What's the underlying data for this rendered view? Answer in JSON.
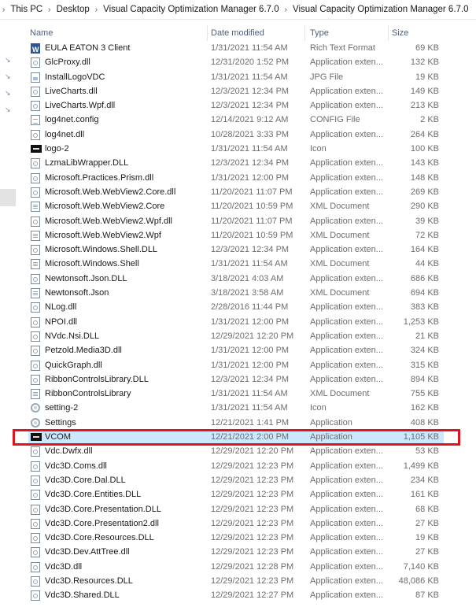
{
  "breadcrumb": [
    "This PC",
    "Desktop",
    "Visual Capacity Optimization Manager 6.7.0",
    "Visual Capacity Optimization Manager 6.7.0"
  ],
  "columns": {
    "name": "Name",
    "date": "Date modified",
    "type": "Type",
    "size": "Size"
  },
  "highlight_color": "#e0141e",
  "selection_color": "#cce8ff",
  "files": [
    {
      "name": "EULA EATON 3 Client",
      "date": "1/31/2021 11:54 AM",
      "type": "Rich Text Format",
      "size": "69 KB",
      "icon": "word-document-icon"
    },
    {
      "name": "GlcProxy.dll",
      "date": "12/31/2020 1:52 PM",
      "type": "Application exten...",
      "size": "132 KB",
      "icon": "dll-file-icon"
    },
    {
      "name": "InstallLogoVDC",
      "date": "1/31/2021 11:54 AM",
      "type": "JPG File",
      "size": "19 KB",
      "icon": "image-file-icon"
    },
    {
      "name": "LiveCharts.dll",
      "date": "12/3/2021 12:34 PM",
      "type": "Application exten...",
      "size": "149 KB",
      "icon": "dll-file-icon"
    },
    {
      "name": "LiveCharts.Wpf.dll",
      "date": "12/3/2021 12:34 PM",
      "type": "Application exten...",
      "size": "213 KB",
      "icon": "dll-file-icon"
    },
    {
      "name": "log4net.config",
      "date": "12/14/2021 9:12 AM",
      "type": "CONFIG File",
      "size": "2 KB",
      "icon": "config-file-icon"
    },
    {
      "name": "log4net.dll",
      "date": "10/28/2021 3:33 PM",
      "type": "Application exten...",
      "size": "264 KB",
      "icon": "dll-file-icon"
    },
    {
      "name": "logo-2",
      "date": "1/31/2021 11:54 AM",
      "type": "Icon",
      "size": "100 KB",
      "icon": "eaton-logo-icon"
    },
    {
      "name": "LzmaLibWrapper.DLL",
      "date": "12/3/2021 12:34 PM",
      "type": "Application exten...",
      "size": "143 KB",
      "icon": "dll-file-icon"
    },
    {
      "name": "Microsoft.Practices.Prism.dll",
      "date": "1/31/2021 12:00 PM",
      "type": "Application exten...",
      "size": "148 KB",
      "icon": "dll-file-icon"
    },
    {
      "name": "Microsoft.Web.WebView2.Core.dll",
      "date": "11/20/2021 11:07 PM",
      "type": "Application exten...",
      "size": "269 KB",
      "icon": "dll-file-icon"
    },
    {
      "name": "Microsoft.Web.WebView2.Core",
      "date": "11/20/2021 10:59 PM",
      "type": "XML Document",
      "size": "290 KB",
      "icon": "xml-file-icon"
    },
    {
      "name": "Microsoft.Web.WebView2.Wpf.dll",
      "date": "11/20/2021 11:07 PM",
      "type": "Application exten...",
      "size": "39 KB",
      "icon": "dll-file-icon"
    },
    {
      "name": "Microsoft.Web.WebView2.Wpf",
      "date": "11/20/2021 10:59 PM",
      "type": "XML Document",
      "size": "72 KB",
      "icon": "xml-file-icon"
    },
    {
      "name": "Microsoft.Windows.Shell.DLL",
      "date": "12/3/2021 12:34 PM",
      "type": "Application exten...",
      "size": "164 KB",
      "icon": "dll-file-icon"
    },
    {
      "name": "Microsoft.Windows.Shell",
      "date": "1/31/2021 11:54 AM",
      "type": "XML Document",
      "size": "44 KB",
      "icon": "xml-file-icon"
    },
    {
      "name": "Newtonsoft.Json.DLL",
      "date": "3/18/2021 4:03 AM",
      "type": "Application exten...",
      "size": "686 KB",
      "icon": "dll-file-icon"
    },
    {
      "name": "Newtonsoft.Json",
      "date": "3/18/2021 3:58 AM",
      "type": "XML Document",
      "size": "694 KB",
      "icon": "xml-file-icon"
    },
    {
      "name": "NLog.dll",
      "date": "2/28/2016 11:44 PM",
      "type": "Application exten...",
      "size": "383 KB",
      "icon": "dll-file-icon"
    },
    {
      "name": "NPOI.dll",
      "date": "1/31/2021 12:00 PM",
      "type": "Application exten...",
      "size": "1,253 KB",
      "icon": "dll-file-icon"
    },
    {
      "name": "NVdc.Nsi.DLL",
      "date": "12/29/2021 12:20 PM",
      "type": "Application exten...",
      "size": "21 KB",
      "icon": "dll-file-icon"
    },
    {
      "name": "Petzold.Media3D.dll",
      "date": "1/31/2021 12:00 PM",
      "type": "Application exten...",
      "size": "324 KB",
      "icon": "dll-file-icon"
    },
    {
      "name": "QuickGraph.dll",
      "date": "1/31/2021 12:00 PM",
      "type": "Application exten...",
      "size": "315 KB",
      "icon": "dll-file-icon"
    },
    {
      "name": "RibbonControlsLibrary.DLL",
      "date": "12/3/2021 12:34 PM",
      "type": "Application exten...",
      "size": "894 KB",
      "icon": "dll-file-icon"
    },
    {
      "name": "RibbonControlsLibrary",
      "date": "1/31/2021 11:54 AM",
      "type": "XML Document",
      "size": "755 KB",
      "icon": "xml-file-icon"
    },
    {
      "name": "setting-2",
      "date": "1/31/2021 11:54 AM",
      "type": "Icon",
      "size": "162 KB",
      "icon": "gear-icon"
    },
    {
      "name": "Settings",
      "date": "12/21/2021 1:41 PM",
      "type": "Application",
      "size": "408 KB",
      "icon": "gear-icon"
    },
    {
      "name": "VCOM",
      "date": "12/21/2021 2:00 PM",
      "type": "Application",
      "size": "1,105 KB",
      "icon": "eaton-logo-icon",
      "selected": true
    },
    {
      "name": "Vdc.Dwfx.dll",
      "date": "12/29/2021 12:20 PM",
      "type": "Application exten...",
      "size": "53 KB",
      "icon": "dll-file-icon"
    },
    {
      "name": "Vdc3D.Coms.dll",
      "date": "12/29/2021 12:23 PM",
      "type": "Application exten...",
      "size": "1,499 KB",
      "icon": "dll-file-icon"
    },
    {
      "name": "Vdc3D.Core.Dal.DLL",
      "date": "12/29/2021 12:23 PM",
      "type": "Application exten...",
      "size": "234 KB",
      "icon": "dll-file-icon"
    },
    {
      "name": "Vdc3D.Core.Entities.DLL",
      "date": "12/29/2021 12:23 PM",
      "type": "Application exten...",
      "size": "161 KB",
      "icon": "dll-file-icon"
    },
    {
      "name": "Vdc3D.Core.Presentation.DLL",
      "date": "12/29/2021 12:23 PM",
      "type": "Application exten...",
      "size": "68 KB",
      "icon": "dll-file-icon"
    },
    {
      "name": "Vdc3D.Core.Presentation2.dll",
      "date": "12/29/2021 12:23 PM",
      "type": "Application exten...",
      "size": "27 KB",
      "icon": "dll-file-icon"
    },
    {
      "name": "Vdc3D.Core.Resources.DLL",
      "date": "12/29/2021 12:23 PM",
      "type": "Application exten...",
      "size": "19 KB",
      "icon": "dll-file-icon"
    },
    {
      "name": "Vdc3D.Dev.AttTree.dll",
      "date": "12/29/2021 12:23 PM",
      "type": "Application exten...",
      "size": "27 KB",
      "icon": "dll-file-icon"
    },
    {
      "name": "Vdc3D.dll",
      "date": "12/29/2021 12:28 PM",
      "type": "Application exten...",
      "size": "7,140 KB",
      "icon": "dll-file-icon"
    },
    {
      "name": "Vdc3D.Resources.DLL",
      "date": "12/29/2021 12:23 PM",
      "type": "Application exten...",
      "size": "48,086 KB",
      "icon": "dll-file-icon"
    },
    {
      "name": "Vdc3D.Shared.DLL",
      "date": "12/29/2021 12:27 PM",
      "type": "Application exten...",
      "size": "87 KB",
      "icon": "dll-file-icon"
    }
  ]
}
